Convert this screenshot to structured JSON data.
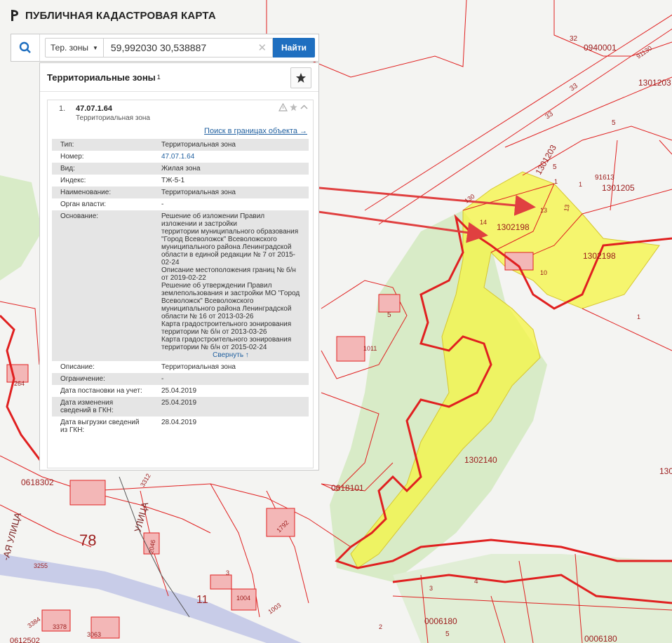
{
  "app": {
    "title": "ПУБЛИЧНАЯ КАДАСТРОВАЯ КАРТА"
  },
  "search": {
    "type_label": "Тер. зоны",
    "query": "59,992030 30,538887",
    "button_label": "Найти"
  },
  "panel": {
    "title": "Территориальные зоны",
    "count": "1",
    "result": {
      "index": "1.",
      "id": "47.07.1.64",
      "subtitle": "Территориальная зона",
      "search_link": "Поиск в границах объекта →",
      "props": [
        {
          "k": "Тип:",
          "v": "Территориальная зона"
        },
        {
          "k": "Номер:",
          "v": "47.07.1.64"
        },
        {
          "k": "Вид:",
          "v": "Жилая зона"
        },
        {
          "k": "Индекс:",
          "v": "ТЖ-5-1"
        },
        {
          "k": "Наименование:",
          "v": "Территориальная зона"
        },
        {
          "k": "Орган власти:",
          "v": "-"
        },
        {
          "k": "Основание:",
          "lines": [
            "Решение об изложении Правил",
            "изложении и застройки",
            "территории муниципального образования",
            "\"Город Всеволожск\" Всеволожского",
            "муниципального района Ленинградской",
            "области в единой редакции № 7 от 2015-",
            "02-24",
            "Описание местоположения границ № б/н",
            "от 2019-02-22",
            "Решение об утверждении Правил",
            "землепользования и застройки МО \"Город",
            "Всеволожск\" Всеволожского",
            "муниципального района Ленинградской",
            "области № 16 от 2013-03-26",
            "Карта градостроительного зонирования",
            "территории № б/н от 2013-03-26",
            "Карта градостроительного зонирования",
            "территории № б/н от 2015-02-24"
          ]
        },
        {
          "k": "Описание:",
          "v": "Территориальная зона"
        },
        {
          "k": "Ограничение:",
          "v": "-"
        },
        {
          "k": "Дата постановки на учет:",
          "v": "25.04.2019"
        },
        {
          "k": "Дата изменения сведений в ГКН:",
          "v": "25.04.2019"
        },
        {
          "k": "Дата выгрузки сведений из ГКН:",
          "v": "28.04.2019"
        }
      ],
      "collapse_label": "Свернуть ↑"
    }
  },
  "map": {
    "labels": {
      "l1": "32",
      "l2": "0940001",
      "l3": "1301203",
      "l4": "91130",
      "l5": "33",
      "l6": "33",
      "l7": "5",
      "l8": "1301203",
      "l9": "5",
      "l10": "91613",
      "l11": "1301205",
      "l12": "1",
      "l13": "1",
      "l14": "130",
      "l15": "13",
      "l16": "13",
      "l17": "14",
      "l18": "1302198",
      "l19": "1302198",
      "l20": "10",
      "l21": "1",
      "l22": "5",
      "l23": "1011",
      "l24": "1302140",
      "l25": "130",
      "l26": "0618101",
      "l27": "0618302",
      "l28": "78",
      "l29": "264",
      "l30": "1792",
      "l31": "2046",
      "l32": "3312",
      "l33": "3255",
      "l34": "3",
      "l35": "1004",
      "l36": "11",
      "l37": "1003",
      "l38": "3384",
      "l39": "3378",
      "l40": "3063",
      "l41": "0006180",
      "l42": "5",
      "l43": "0006180",
      "l44": "4",
      "l45": "2",
      "l46": "3",
      "l47": "-АЯ УЛИЦА",
      "l48": "УЛИЦА",
      "l49": "0612502"
    },
    "colors": {
      "boundary": "#e02020",
      "zone": "#f5f542",
      "greenery": "#d8ebc7",
      "arrow": "#e04040"
    }
  }
}
